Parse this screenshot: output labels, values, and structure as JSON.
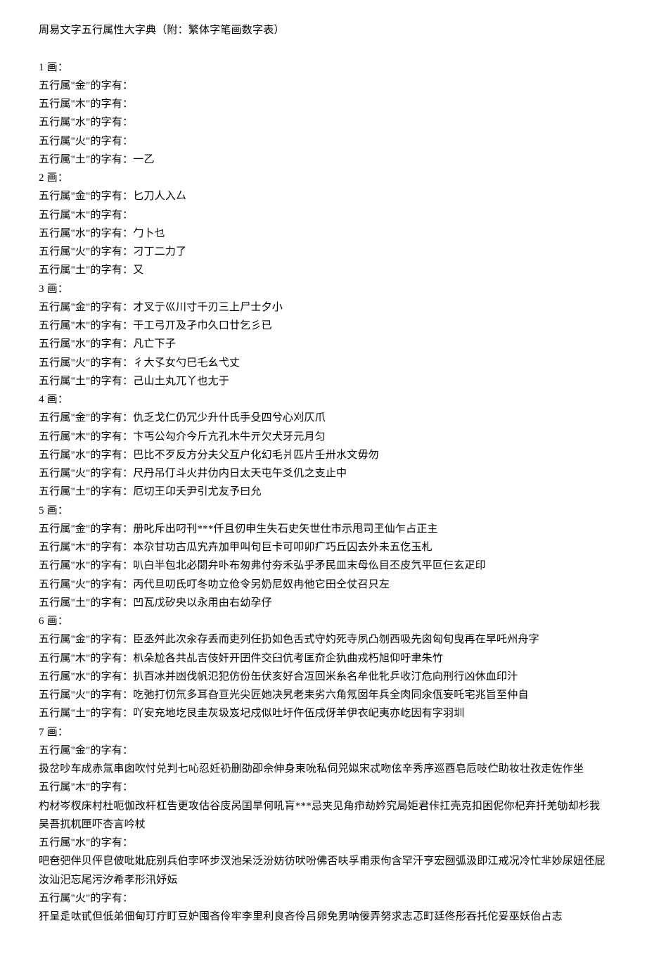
{
  "doc": {
    "title": "周易文字五行属性大字典（附：繁体字笔画数字表）",
    "sections": [
      {
        "label": "1 画：",
        "lines": [
          "五行属\"金\"的字有：",
          "五行属\"木\"的字有：",
          "五行属\"水\"的字有：",
          "五行属\"火\"的字有：",
          "五行属\"土\"的字有：一乙"
        ]
      },
      {
        "label": "2 画：",
        "lines": [
          "五行属\"金\"的字有：匕刀人入厶",
          "五行属\"木\"的字有：",
          "五行属\"水\"的字有：勹卜乜",
          "五行属\"火\"的字有：刁丁二力了",
          "五行属\"土\"的字有：又"
        ]
      },
      {
        "label": "3 画：",
        "lines": [
          "五行属\"金\"的字有：才叉亍巛川寸千刃三上尸士夕小",
          "五行属\"木\"的字有：干工弓丌及孑巾久口廿乞彡已",
          "五行属\"水\"的字有：凡亡下子",
          "五行属\"火\"的字有：彳大孓女勺巳乇幺弋丈",
          "五行属\"土\"的字有：己山土丸兀丫也尢于"
        ]
      },
      {
        "label": "4 画：",
        "lines": [
          "五行属\"金\"的字有：仇乏戈仁仍冗少升什氏手殳四兮心刈仄爪",
          "五行属\"木\"的字有：卞丐公勾介今斤亢孔木牛亓欠犬牙元月匀",
          "五行属\"水\"的字有：巴比不歹反方分夫父互户化幻毛爿匹片壬卅水文毋勿",
          "五行属\"火\"的字有：尺丹吊仃斗火井仂内日太天屯午爻仉之支止中",
          "五行属\"土\"的字有：厄切王卬夭尹引尤友予曰允"
        ]
      },
      {
        "label": "5 画：",
        "lines": [
          "五行属\"金\"的字有：册叱斥出叼刊***仟且仞申生失石史矢世仕市示甩司玊仙乍占正主",
          "五行属\"木\"的字有：本尕甘功古瓜宄卉加甲叫句巨卡可叩卯疒巧丘囚去外未五仡玉札",
          "五行属\"水\"的字有：叭白半包北必閟弁卟布匆弗付夯禾弘乎矛民皿末母仫目丕皮氕平叵仨玄疋印",
          "五行属\"火\"的字有：丙代旦叨氐叮冬叻立伧令另奶尼奴冉他它田仝仗召只左",
          "五行属\"土\"的字有：凹瓦戊矽央以永用由右幼孕仔"
        ]
      },
      {
        "label": "6 画：",
        "lines": [
          "五行属\"金\"的字有：臣丞舛此次汆存丢而吏列任扔如色舌式守妁死寺夙凸刎西吸先囟匈旬曳再在早吒州舟字",
          "五行属\"木\"的字有：朳朵尬各共乩吉伎奸开囝件交臼伉考匡夼企犰曲戎朽旭仰吁聿朱竹",
          "五行属\"水\"的字有：扒百冰并凼伐帆氾犯仿份缶伏亥好合冱回米糸名牟仳牝乒收汀危向刑行凶休血印汁",
          "五行属\"火\"的字有：吃弛打忉氘多耳旮亘光尖匠她决旯老耒劣六角氖囡年兵全肉同氽佤妄吒宅兆旨至仲自",
          "五行属\"土\"的字有：吖安充地圪艮圭灰圾岌圮戍似吐圩仵伍戌伢羊伊衣屺夷亦屹因有字羽圳"
        ]
      },
      {
        "label": "7 画：",
        "lines": [
          "五行属\"金\"的字有：",
          "扱岔吵车成赤氚串囱吹忖兑判七吣忍妊礽删劭卲佘伸身束吮私伺兕姒宋忒吻伭辛秀序巡酉皂卮吱伫助妆壮孜走佐作坐",
          "五行属\"木\"的字有：",
          "杓材岑杈床村杜呃伽改杆杠告更攻估谷庋呙囯旱何吼肓***忌夹见角疖劫妗究局姖君佧扛壳克扣困伲你杞弃扦羌劬却杉我吴吾扤杌匣吓杏言吟杖",
          "五行属\"水\"的字有：",
          "吧夿弝伴贝伻皀佊吡妣庇别兵伯孛吥步汊池呆泛汾妨彷吠吩佛否呋孚甫汞佝含罕汗亨宏囫弧汲即江戒况冷忙芈妙尿妞伾屁汝汕汜忘尾污汐希孝形汛妤妘",
          "五行属\"火\"的字有：",
          "犴呈辵呔甙但低弟佃甸玎疔盯豆妒囤吝伶牢李里利良吝伶吕卵免男呐佞弄努求志忑町廷佟彤吞托佗妥巫妖佁占志"
        ]
      }
    ]
  }
}
